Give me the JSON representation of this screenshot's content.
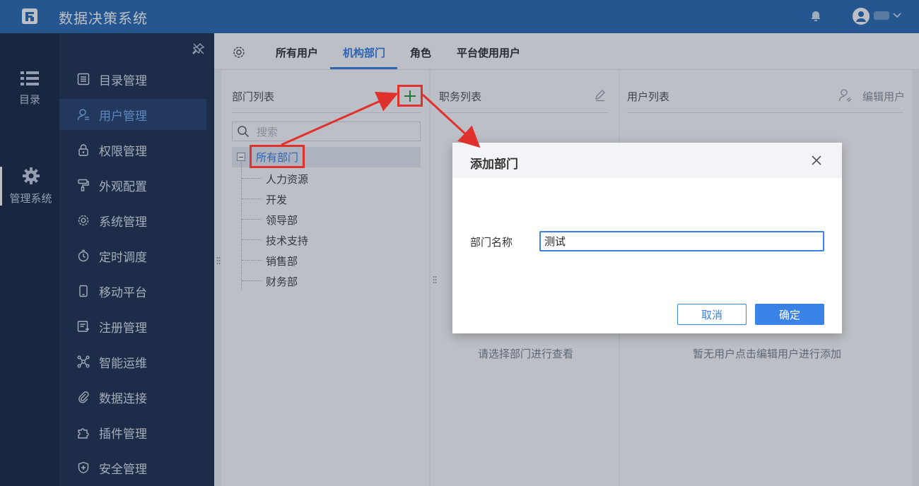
{
  "app": {
    "title": "数据决策系统"
  },
  "rail": {
    "items": [
      {
        "label": "目录",
        "icon": "list-icon"
      },
      {
        "label": "管理系统",
        "icon": "gear-icon"
      }
    ]
  },
  "menu": {
    "items": [
      {
        "label": "目录管理",
        "icon": "catalog-icon"
      },
      {
        "label": "用户管理",
        "icon": "user-icon"
      },
      {
        "label": "权限管理",
        "icon": "lock-icon"
      },
      {
        "label": "外观配置",
        "icon": "paint-roller-icon"
      },
      {
        "label": "系统管理",
        "icon": "gear-icon"
      },
      {
        "label": "定时调度",
        "icon": "timer-icon"
      },
      {
        "label": "移动平台",
        "icon": "mobile-icon"
      },
      {
        "label": "注册管理",
        "icon": "register-icon"
      },
      {
        "label": "智能运维",
        "icon": "ops-icon"
      },
      {
        "label": "数据连接",
        "icon": "link-icon"
      },
      {
        "label": "插件管理",
        "icon": "puzzle-icon"
      },
      {
        "label": "安全管理",
        "icon": "shield-icon"
      }
    ],
    "active_index": 1
  },
  "tabs": {
    "items": [
      "所有用户",
      "机构部门",
      "角色",
      "平台使用用户"
    ],
    "active_index": 1
  },
  "dept_panel": {
    "title": "部门列表",
    "search_placeholder": "搜索",
    "root": "所有部门",
    "children": [
      "人力资源",
      "开发",
      "领导部",
      "技术支持",
      "销售部",
      "财务部"
    ]
  },
  "duty_panel": {
    "title": "职务列表",
    "empty_text": "请选择部门进行查看"
  },
  "user_panel": {
    "title": "用户列表",
    "edit_label": "编辑用户",
    "empty_text": "暂无用户点击编辑用户进行添加"
  },
  "dialog": {
    "title": "添加部门",
    "field_label": "部门名称",
    "field_value": "测试",
    "cancel_label": "取消",
    "ok_label": "确定"
  },
  "colors": {
    "topbar": "#2f6eb4",
    "accent": "#3a82e6",
    "highlight": "#e0312d",
    "rail_bg": "#1d2b46",
    "menu_bg": "#223454"
  }
}
